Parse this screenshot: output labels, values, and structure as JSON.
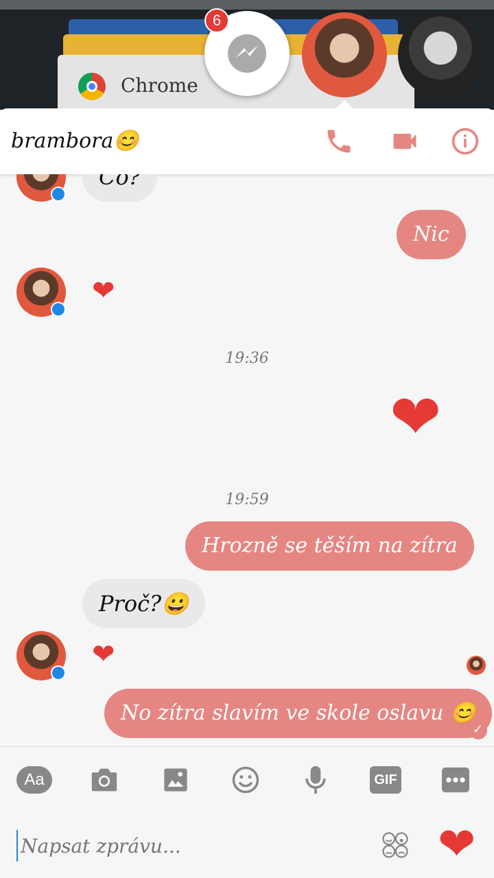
{
  "app": {
    "recent_app_label": "Chrome",
    "chat_head_badge": "6"
  },
  "header": {
    "contact_name": "brambora😊"
  },
  "messages": [
    {
      "side": "in",
      "text": "Co?"
    },
    {
      "side": "out",
      "text": "Nic"
    },
    {
      "side": "in",
      "type": "heart"
    },
    {
      "type": "time",
      "text": "19:36"
    },
    {
      "side": "out",
      "type": "big-heart"
    },
    {
      "type": "time",
      "text": "19:59"
    },
    {
      "side": "out",
      "text": "Hrozně se těším na zítra"
    },
    {
      "side": "in",
      "text": "Proč?😀"
    },
    {
      "side": "in",
      "type": "heart"
    },
    {
      "side": "out",
      "text": "No zítra slavím ve skole oslavu 😊"
    }
  ],
  "toolbar": {
    "text_label": "Aa",
    "gif_label": "GIF",
    "icons": [
      "camera-icon",
      "image-icon",
      "emoji-icon",
      "microphone-icon",
      "more-icon"
    ]
  },
  "composer": {
    "placeholder": "Napsat zprávu..."
  },
  "colors": {
    "accent": "#e58682",
    "heart": "#e53935"
  }
}
